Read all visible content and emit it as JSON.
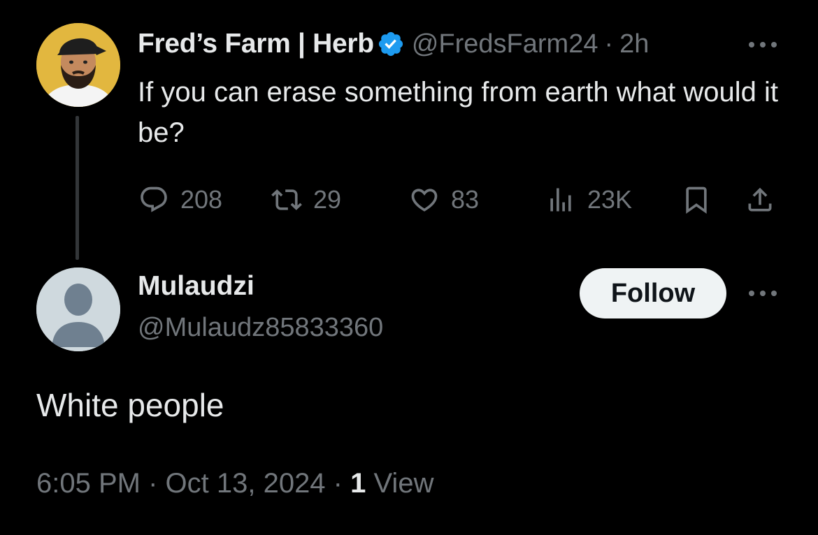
{
  "original_tweet": {
    "display_name": "Fred’s Farm | Herb",
    "handle": "@FredsFarm24",
    "separator": "·",
    "time": "2h",
    "text": "If you can erase something from earth what would it be?",
    "stats": {
      "replies": "208",
      "retweets": "29",
      "likes": "83",
      "views": "23K"
    }
  },
  "reply": {
    "display_name": "Mulaudzi",
    "handle": "@Mulaudz85833360",
    "follow_label": "Follow",
    "text": "White people",
    "timestamp": "6:05 PM · Oct 13, 2024 · ",
    "views_count": "1",
    "views_label": " View"
  },
  "colors": {
    "background": "#000000",
    "primary_text": "#e7e9ea",
    "secondary_text": "#71767b",
    "verified_blue": "#1d9bf0",
    "follow_button_bg": "#eff3f4",
    "avatar_bg_fred": "#e2b73f",
    "avatar_bg_default": "#cfd9de"
  },
  "icons": {
    "reply": "reply-icon",
    "retweet": "retweet-icon",
    "like": "heart-icon",
    "views": "views-icon",
    "bookmark": "bookmark-icon",
    "share": "share-icon",
    "more": "more-icon",
    "verified": "verified-badge-icon"
  }
}
